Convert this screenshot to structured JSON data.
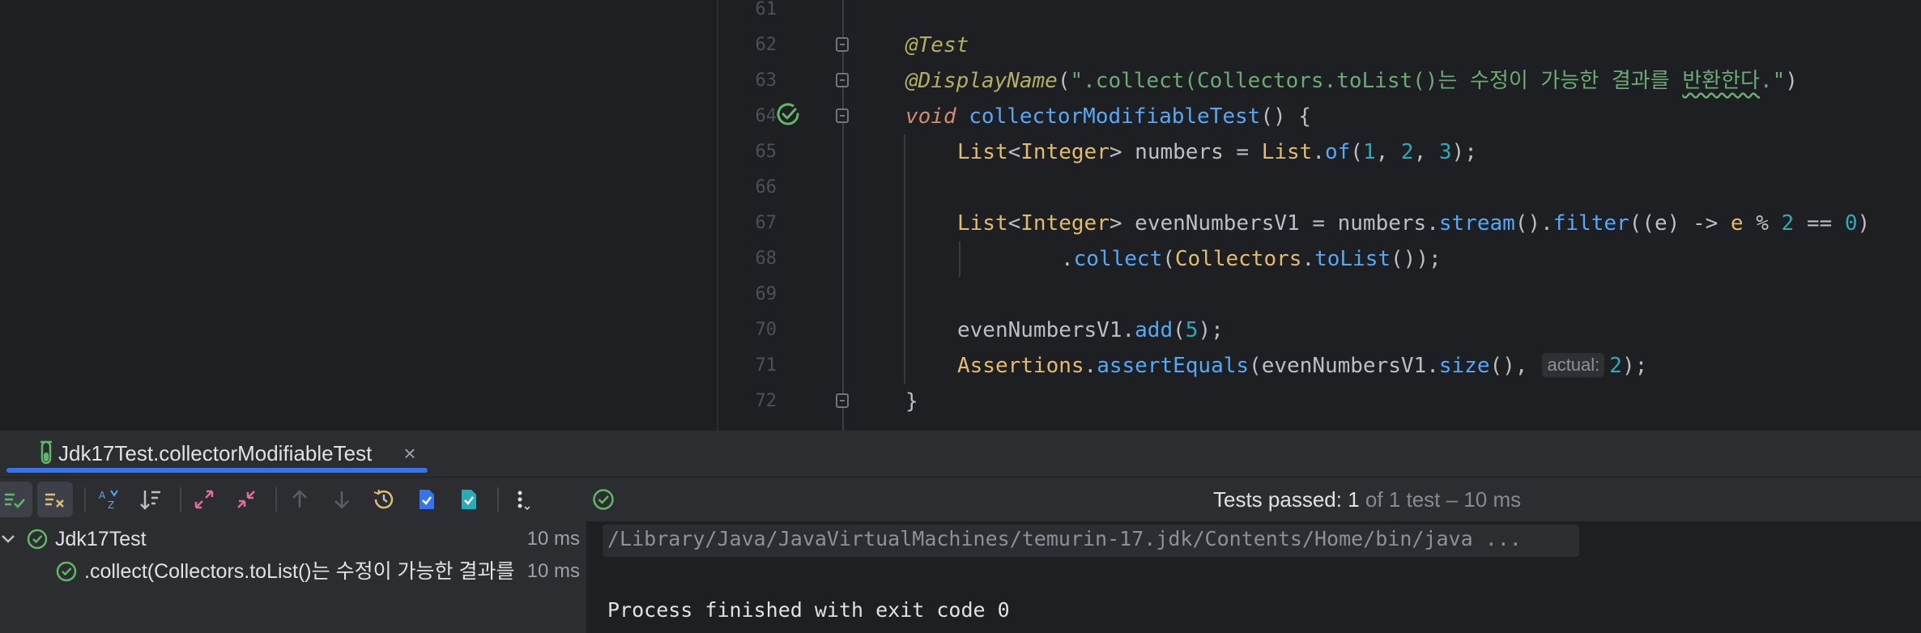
{
  "editor": {
    "line_numbers": [
      "61",
      "62",
      "63",
      "64",
      "65",
      "66",
      "67",
      "68",
      "69",
      "70",
      "71",
      "72"
    ],
    "annotation_test": "@Test",
    "annotation_display": "@DisplayName",
    "display_open": "(",
    "display_string_part1": "\".collect(Collectors.toList()는 수정이 가능한 결과를 ",
    "display_string_typo": "반환한다",
    "display_string_part2": ".\"",
    "display_close": ")",
    "method_keyword": "void",
    "method_name": "collectorModifiableTest",
    "method_rest": "() {",
    "line65": {
      "type1": "List",
      "lt": "<",
      "type2": "Integer",
      "gt": ">",
      "var": " numbers = ",
      "cls": "List",
      "dot": ".",
      "fn": "of",
      "args_open": "(",
      "n1": "1",
      "c1": ", ",
      "n2": "2",
      "c2": ", ",
      "n3": "3",
      "args_close": ");"
    },
    "line67": {
      "type1": "List",
      "lt": "<",
      "type2": "Integer",
      "gt": ">",
      "var": " evenNumbersV1 = numbers.",
      "fn1": "stream",
      "p1": "().",
      "fn2": "filter",
      "p2": "((e) -> ",
      "e": "e",
      "op": " % ",
      "n2": "2",
      "eq": " == ",
      "n0": "0",
      "close": ")"
    },
    "line68": {
      "dot": ".",
      "fn": "collect",
      "open": "(",
      "cls": "Collectors",
      "dot2": ".",
      "fn2": "toList",
      "close": "());"
    },
    "line70": {
      "var": "evenNumbersV1.",
      "fn": "add",
      "open": "(",
      "n": "5",
      "close": ");"
    },
    "line71": {
      "cls": "Assertions",
      "dot": ".",
      "fn": "assertEquals",
      "open": "(evenNumbersV1.",
      "fn2": "size",
      "mid": "(),",
      "hint": "actual:",
      "n": "2",
      "close": ");"
    },
    "line72": "}"
  },
  "tool_window": {
    "tab_title": "Jdk17Test.collectorModifiableTest",
    "tab_close": "×"
  },
  "status": {
    "label": "Tests passed: ",
    "passed": "1",
    "rest": " of 1 test – 10 ms"
  },
  "tree": {
    "root_label": "Jdk17Test",
    "root_time": "10 ms",
    "child_label": ".collect(Collectors.toList()는 수정이 가능한 결과를",
    "child_time": "10 ms"
  },
  "console": {
    "command": "/Library/Java/JavaVirtualMachines/temurin-17.jdk/Contents/Home/bin/java ...",
    "exit": "Process finished with exit code 0"
  },
  "colors": {
    "accent": "#3574f0",
    "pass_green": "#5fb865",
    "editor_bg": "#1e1f22",
    "panel_bg": "#2b2d30"
  }
}
